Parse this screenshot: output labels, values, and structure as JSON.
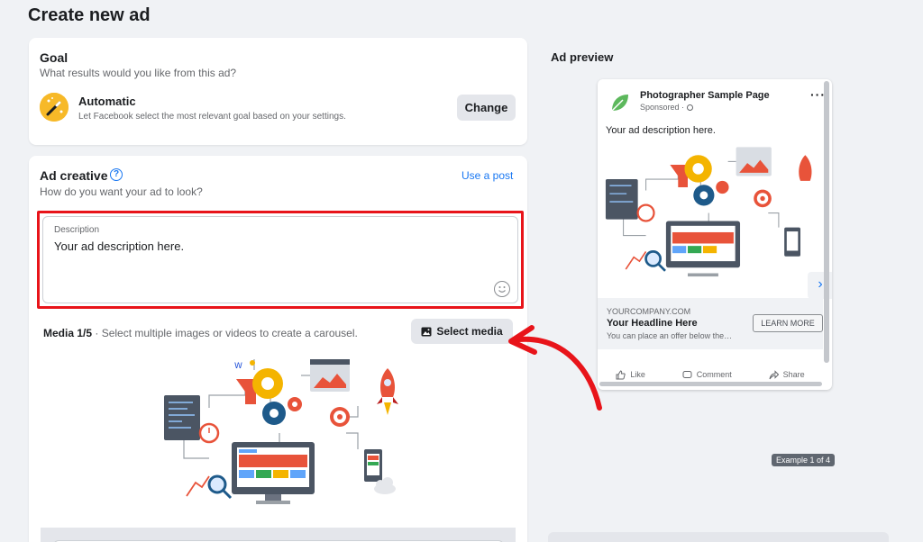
{
  "header": {
    "title": "Create new ad"
  },
  "goal": {
    "heading": "Goal",
    "subtitle": "What results would you like from this ad?",
    "selected": {
      "name": "Automatic",
      "description": "Let Facebook select the most relevant goal based on your settings."
    },
    "change_label": "Change"
  },
  "creative": {
    "heading": "Ad creative",
    "help_icon": "?",
    "subtitle": "How do you want your ad to look?",
    "use_post_label": "Use a post",
    "description": {
      "label": "Description",
      "value": "Your ad description here."
    },
    "media": {
      "count_label": "Media 1/5",
      "hint": "· Select multiple images or videos to create a carousel.",
      "select_label": "Select media"
    }
  },
  "preview": {
    "title": "Ad preview",
    "page_name": "Photographer Sample Page",
    "sponsored": "Sponsored · ",
    "more_label": "···",
    "ad_text": "Your ad description here.",
    "domain": "YOURCOMPANY.COM",
    "headline": "Your Headline Here",
    "offer": "You can place an offer below the…",
    "cta_label": "LEARN MORE",
    "next_label": "›",
    "actions": {
      "like": "Like",
      "comment": "Comment",
      "share": "Share"
    },
    "example_label": "Example 1 of 4"
  },
  "colors": {
    "accent": "#1877f2",
    "highlight_box": "#e8141a",
    "arrow": "#e8141a",
    "button_grey": "#e4e6eb"
  }
}
